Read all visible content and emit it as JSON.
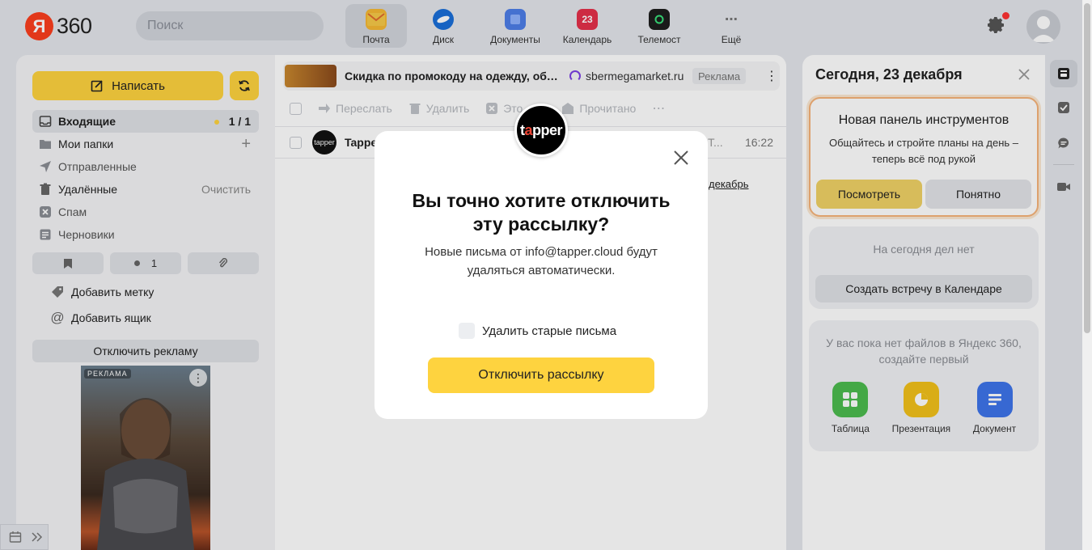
{
  "header": {
    "logo_ya": "Я",
    "logo_360": "360",
    "search_placeholder": "Поиск",
    "services": [
      {
        "label": "Почта",
        "icon": "mail-icon",
        "active": true
      },
      {
        "label": "Диск",
        "icon": "disk-icon"
      },
      {
        "label": "Документы",
        "icon": "documents-icon"
      },
      {
        "label": "Календарь",
        "icon": "calendar-icon",
        "badge": "23"
      },
      {
        "label": "Телемост",
        "icon": "telemost-icon"
      },
      {
        "label": "Ещё",
        "icon": "more-icon"
      }
    ]
  },
  "sidebar": {
    "compose_label": "Написать",
    "folders": [
      {
        "label": "Входящие",
        "count": "1 / 1",
        "selected": true
      },
      {
        "label": "Мои папки",
        "action": "+"
      },
      {
        "label": "Отправленные"
      },
      {
        "label": "Удалённые",
        "action": "Очистить"
      },
      {
        "label": "Спам"
      },
      {
        "label": "Черновики"
      }
    ],
    "chip_unread_count": "1",
    "add_label": "Добавить метку",
    "add_mailbox": "Добавить ящик",
    "disable_ads": "Отключить рекламу",
    "ad_label": "РЕКЛАМА"
  },
  "maillist": {
    "ad": {
      "title": "Скидка по промокоду на одежду, обув…",
      "domain": "sbermegamarket.ru",
      "badge": "Реклама"
    },
    "toolbar": [
      "Переслать",
      "Удалить",
      "Это",
      "Прочитано"
    ],
    "message": {
      "from": "Tapper",
      "snippet_tail": "Т...",
      "time": "16:22",
      "avatar_text": "tapper"
    },
    "link_text": "декабрь"
  },
  "modal": {
    "logo_text_a": "t",
    "logo_text_b": "a",
    "logo_text_c": "pper",
    "title": "Вы точно хотите отключить эту рассылку?",
    "text": "Новые письма от info@tapper.cloud будут удаляться автоматически.",
    "checkbox_label": "Удалить старые письма",
    "confirm_label": "Отключить рассылку"
  },
  "rightpanel": {
    "date": "Сегодня, 23 декабря",
    "promo": {
      "title": "Новая панель инструментов",
      "text": "Общайтесь и стройте планы на день – теперь всё под рукой",
      "primary": "Посмотреть",
      "secondary": "Понятно"
    },
    "tasks": {
      "empty": "На сегодня дел нет",
      "button": "Создать встречу в Календаре"
    },
    "files": {
      "empty": "У вас пока нет файлов в Яндекс 360, создайте первый",
      "apps": [
        {
          "label": "Таблица",
          "color": "#4cbb4e"
        },
        {
          "label": "Презентация",
          "color": "#f2c11a"
        },
        {
          "label": "Документ",
          "color": "#3e74ea"
        }
      ]
    }
  },
  "colors": {
    "accent": "#fed33f",
    "brand_red": "#fc3f1d"
  }
}
